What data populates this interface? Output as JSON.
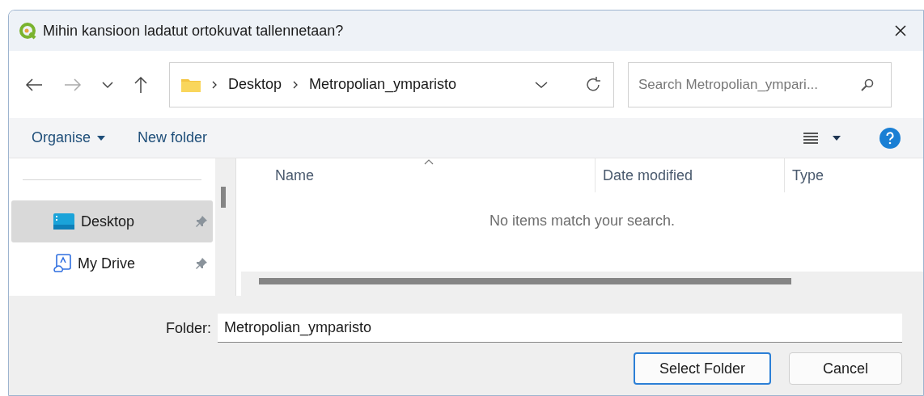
{
  "window": {
    "title": "Mihin kansioon ladatut ortokuvat tallennetaan?"
  },
  "address_bar": {
    "breadcrumb": [
      "Desktop",
      "Metropolian_ymparisto"
    ]
  },
  "search": {
    "placeholder": "Search Metropolian_ympari..."
  },
  "toolbar": {
    "organise": "Organise",
    "new_folder": "New folder"
  },
  "sidebar": {
    "items": [
      {
        "label": "Desktop",
        "kind": "desktop",
        "selected": true
      },
      {
        "label": "My Drive",
        "kind": "drive",
        "selected": false
      }
    ]
  },
  "table": {
    "columns": [
      "Name",
      "Date modified",
      "Type"
    ],
    "empty_message": "No items match your search."
  },
  "folder_field": {
    "label": "Folder:",
    "value": "Metropolian_ymparisto"
  },
  "buttons": [
    {
      "label": "Select Folder",
      "kind": "primary"
    },
    {
      "label": "Cancel",
      "kind": "secondary"
    }
  ]
}
